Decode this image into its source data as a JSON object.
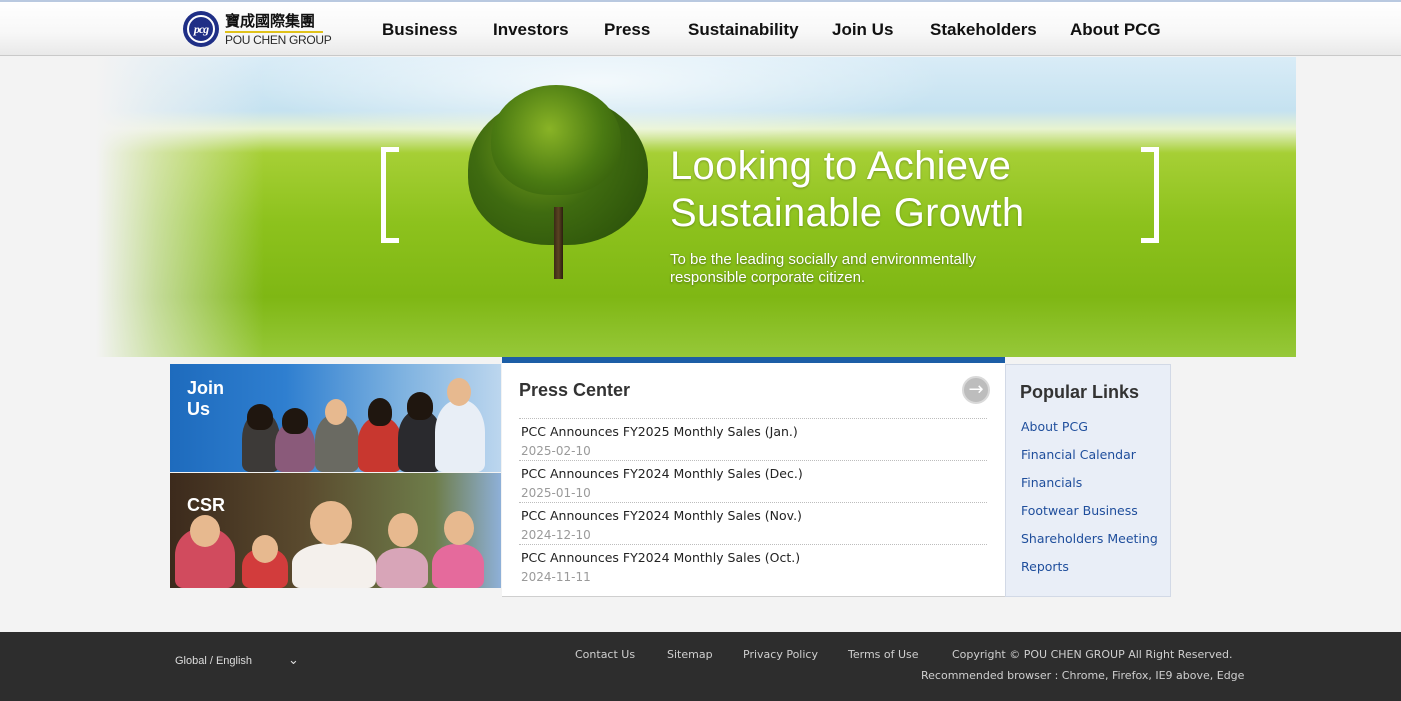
{
  "header": {
    "logo_cn": "寶成國際集團",
    "logo_en": "POU CHEN GROUP",
    "logo_mark": "pcg",
    "nav": [
      "Business",
      "Investors",
      "Press",
      "Sustainability",
      "Join Us",
      "Stakeholders",
      "About PCG"
    ]
  },
  "hero": {
    "title_line1": "Looking to Achieve",
    "title_line2": "Sustainable Growth",
    "subtitle": "To be the leading socially and environmentally responsible corporate citizen."
  },
  "promos": {
    "join": "Join Us",
    "csr": "CSR"
  },
  "press": {
    "title": "Press Center",
    "more_icon": "arrow-right-icon",
    "items": [
      {
        "headline": "PCC Announces FY2025 Monthly Sales (Jan.)",
        "date": "2025-02-10"
      },
      {
        "headline": "PCC Announces FY2024 Monthly Sales (Dec.)",
        "date": "2025-01-10"
      },
      {
        "headline": "PCC Announces FY2024 Monthly Sales (Nov.)",
        "date": "2024-12-10"
      },
      {
        "headline": "PCC Announces FY2024 Monthly Sales (Oct.)",
        "date": "2024-11-11"
      }
    ]
  },
  "popular": {
    "title": "Popular Links",
    "links": [
      "About PCG",
      "Financial Calendar",
      "Financials",
      "Footwear Business",
      "Shareholders Meeting",
      "Reports"
    ]
  },
  "footer": {
    "language": "Global / English",
    "links": [
      "Contact Us",
      "Sitemap",
      "Privacy Policy",
      "Terms of Use"
    ],
    "copyright": "Copyright © POU CHEN GROUP All Right Reserved.",
    "browser_note": "Recommended browser : Chrome, Firefox, IE9 above, Edge"
  },
  "colors": {
    "accent_blue": "#1c5ea6",
    "link_blue": "#1f4e9c",
    "logo_navy": "#1f2f86",
    "footer_bg": "#2d2d2d"
  }
}
